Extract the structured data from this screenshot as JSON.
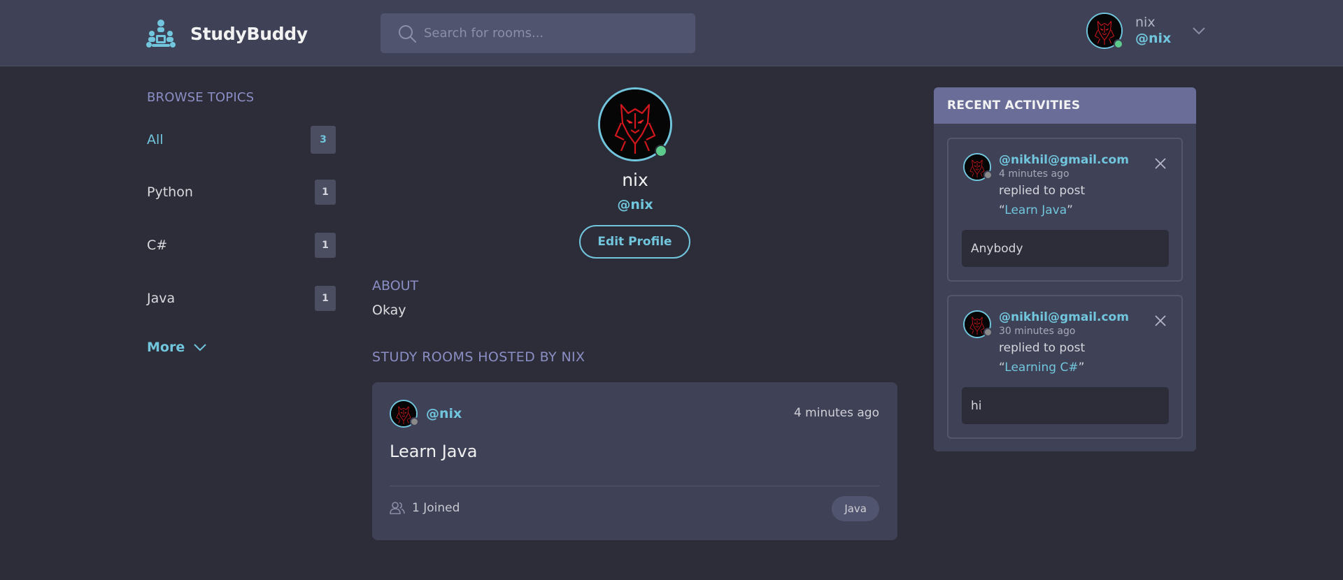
{
  "header": {
    "app_title": "StudyBuddy",
    "search": {
      "placeholder": "Search for rooms...",
      "value": ""
    },
    "user": {
      "name": "nix",
      "handle": "@nix"
    }
  },
  "sidebar": {
    "title": "BROWSE TOPICS",
    "topics": [
      {
        "label": "All",
        "count": "3",
        "active": true
      },
      {
        "label": "Python",
        "count": "1"
      },
      {
        "label": "C#",
        "count": "1"
      },
      {
        "label": "Java",
        "count": "1"
      }
    ],
    "more_label": "More"
  },
  "profile": {
    "name": "nix",
    "handle": "@nix",
    "edit_label": "Edit Profile",
    "about_title": "ABOUT",
    "about_text": "Okay",
    "rooms_title": "STUDY ROOMS HOSTED BY NIX"
  },
  "rooms": [
    {
      "host": "@nix",
      "time": "4 minutes ago",
      "title": "Learn Java",
      "joined": "1 Joined",
      "topic": "Java"
    }
  ],
  "activities": {
    "title": "RECENT ACTIVITIES",
    "items": [
      {
        "user": "@nikhil@gmail.com",
        "time": "4 minutes ago",
        "action": "replied to post",
        "post_open": "“",
        "post": "Learn Java",
        "post_close": "”",
        "reply": "Anybody"
      },
      {
        "user": "@nikhil@gmail.com",
        "time": "30 minutes ago",
        "action": "replied to post",
        "post_open": "“",
        "post": "Learning C#",
        "post_close": "”",
        "reply": "hi"
      }
    ]
  },
  "colors": {
    "background": "#2d2d39",
    "surface": "#3f4156",
    "accent": "#71c6dd",
    "muted_heading": "#8b8ec5",
    "activity_header": "#696d97",
    "online": "#5dcb8c",
    "offline": "#8a8a8a"
  },
  "icons": [
    "studybuddy-logo-icon",
    "search-icon",
    "chevron-down-icon",
    "users-icon",
    "close-icon",
    "avatar-panther-image"
  ]
}
